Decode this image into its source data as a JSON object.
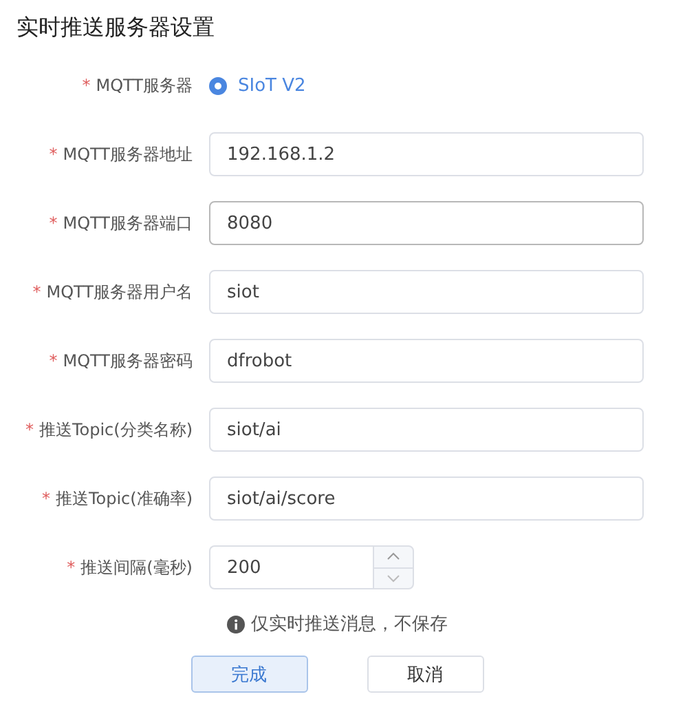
{
  "title": "实时推送服务器设置",
  "fields": [
    {
      "kind": "radio",
      "label": "MQTT服务器",
      "required_mark": "*",
      "options": [
        {
          "label": "SIoT V2",
          "selected": true
        }
      ]
    },
    {
      "kind": "text",
      "label": "MQTT服务器地址",
      "required_mark": "*",
      "value": "192.168.1.2",
      "focused": false
    },
    {
      "kind": "text",
      "label": "MQTT服务器端口",
      "required_mark": "*",
      "value": "8080",
      "focused": true
    },
    {
      "kind": "text",
      "label": "MQTT服务器用户名",
      "required_mark": "*",
      "value": "siot",
      "focused": false
    },
    {
      "kind": "text",
      "label": "MQTT服务器密码",
      "required_mark": "*",
      "value": "dfrobot",
      "focused": false
    },
    {
      "kind": "text",
      "label": "推送Topic(分类名称)",
      "required_mark": "*",
      "value": "siot/ai",
      "focused": false
    },
    {
      "kind": "text",
      "label": "推送Topic(准确率)",
      "required_mark": "*",
      "value": "siot/ai/score",
      "focused": false
    },
    {
      "kind": "number",
      "label": "推送间隔(毫秒)",
      "required_mark": "*",
      "value": "200",
      "focused": false
    }
  ],
  "note": "仅实时推送消息，不保存",
  "buttons": [
    {
      "label": "完成",
      "kind": "primary"
    },
    {
      "label": "取消",
      "kind": "default"
    }
  ]
}
